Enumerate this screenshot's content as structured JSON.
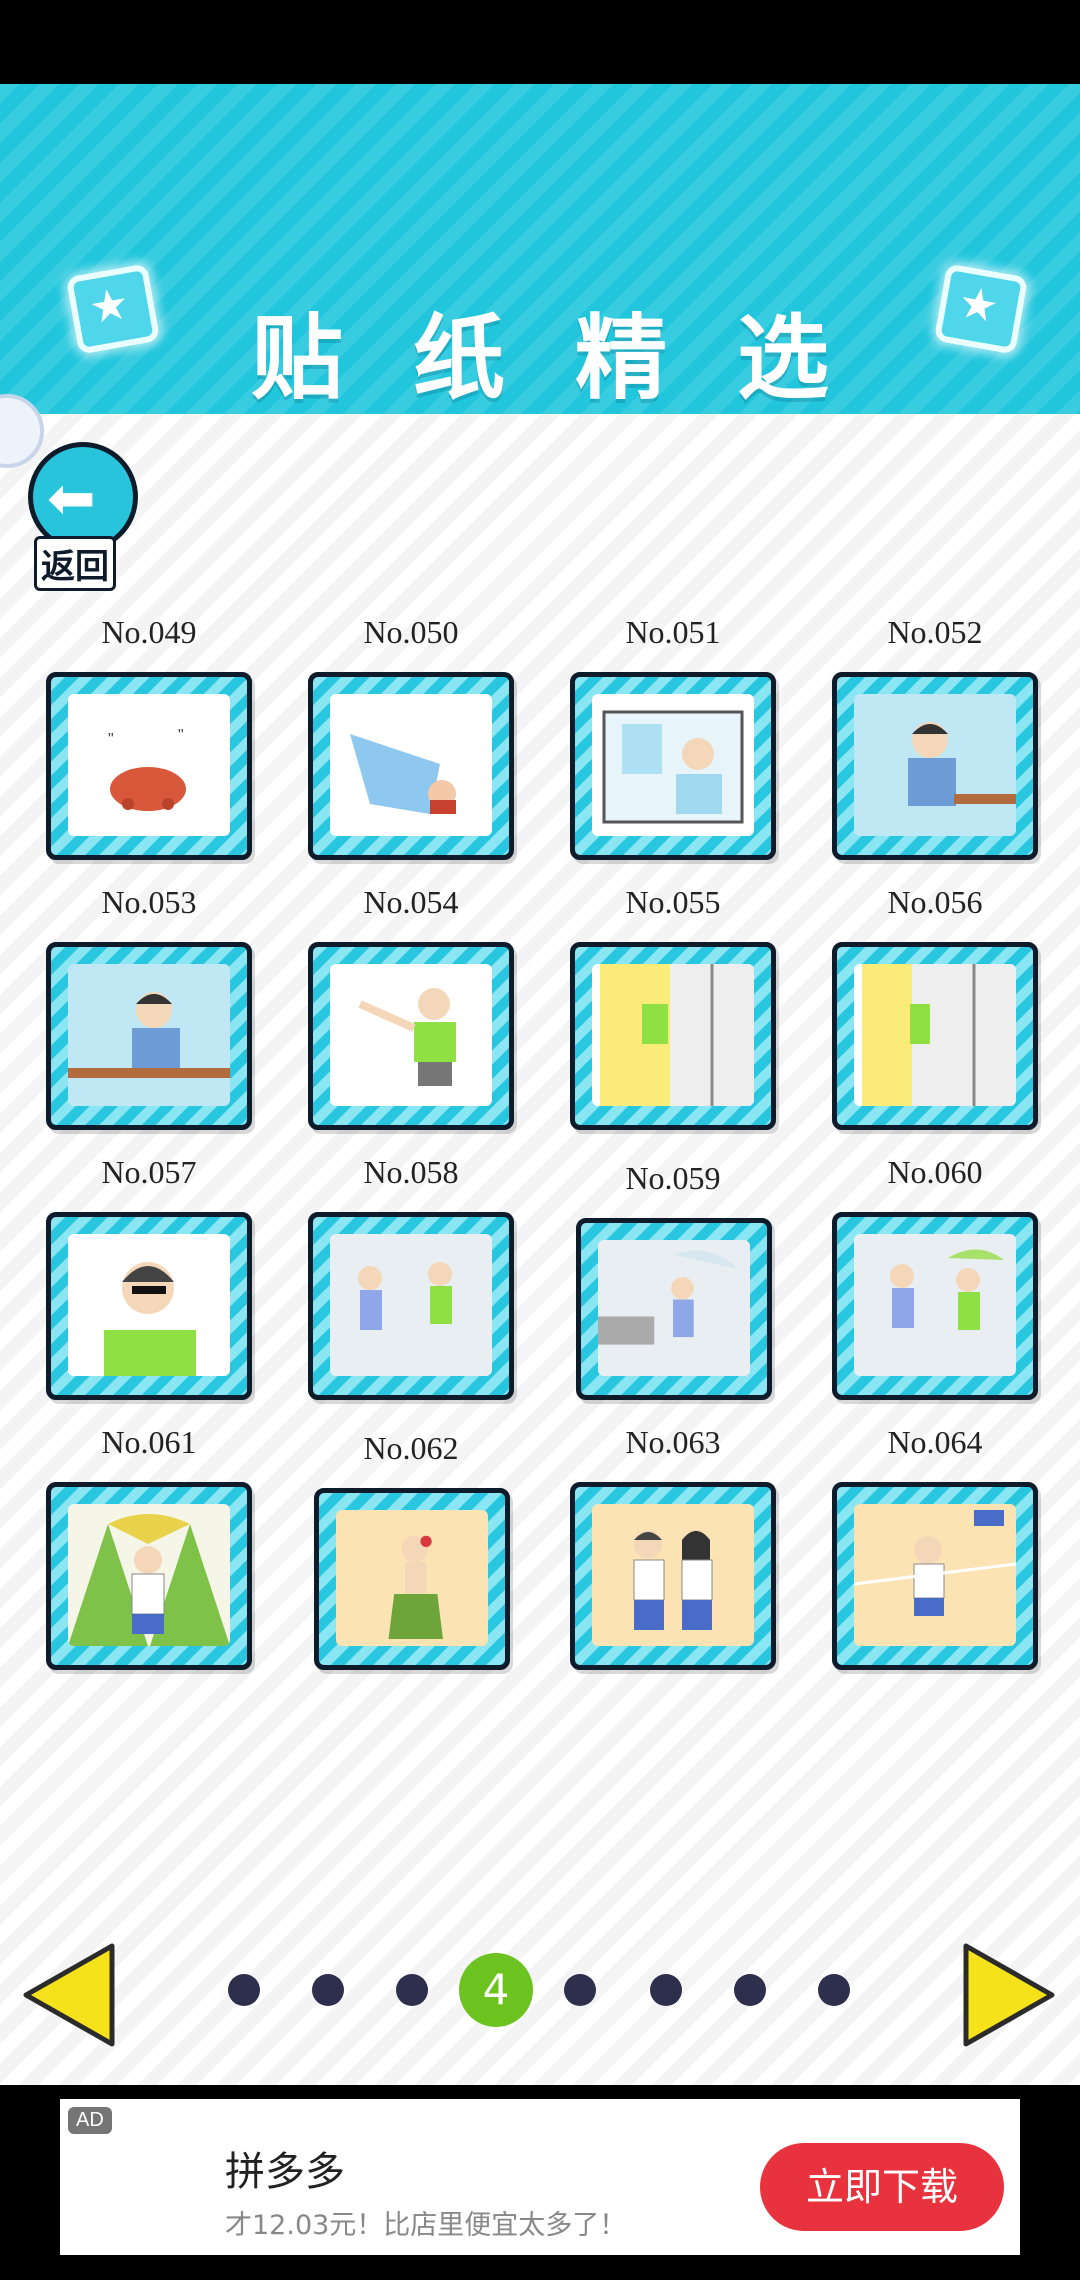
{
  "header": {
    "title": "贴纸精选"
  },
  "back_button": {
    "label": "返回"
  },
  "stickers": [
    {
      "no": "No.049"
    },
    {
      "no": "No.050"
    },
    {
      "no": "No.051"
    },
    {
      "no": "No.052"
    },
    {
      "no": "No.053"
    },
    {
      "no": "No.054"
    },
    {
      "no": "No.055"
    },
    {
      "no": "No.056"
    },
    {
      "no": "No.057"
    },
    {
      "no": "No.058"
    },
    {
      "no": "No.059"
    },
    {
      "no": "No.060"
    },
    {
      "no": "No.061"
    },
    {
      "no": "No.062"
    },
    {
      "no": "No.063"
    },
    {
      "no": "No.064"
    }
  ],
  "pagination": {
    "current_page": "4",
    "total_dots": 8,
    "active_index": 3
  },
  "ad": {
    "tag": "AD",
    "title": "拼多多",
    "subtitle": "才12.03元！比店里便宜太多了！",
    "cta": "立即下载"
  },
  "colors": {
    "header": "#21c6dd",
    "frame": "#28c7df",
    "active_dot": "#6cc31f",
    "nav_arrow": "#f6e21a",
    "ad_button": "#e8323e"
  }
}
